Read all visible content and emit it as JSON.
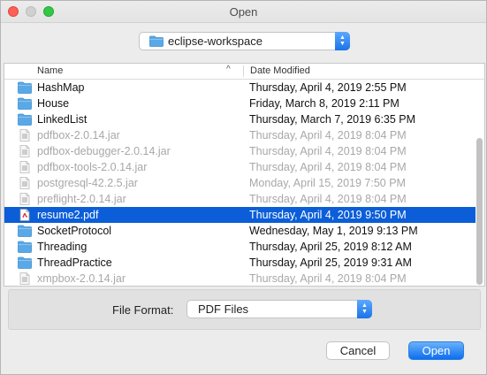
{
  "window": {
    "title": "Open"
  },
  "location": {
    "value": "eclipse-workspace"
  },
  "list": {
    "headers": {
      "name": "Name",
      "date": "Date Modified"
    },
    "rows": [
      {
        "name": "HashMap",
        "date": "Thursday, April 4, 2019 2:55 PM",
        "icon": "folder-icon",
        "enabled": true,
        "selected": false
      },
      {
        "name": "House",
        "date": "Friday, March 8, 2019 2:11 PM",
        "icon": "folder-icon",
        "enabled": true,
        "selected": false
      },
      {
        "name": "LinkedList",
        "date": "Thursday, March 7, 2019 6:35 PM",
        "icon": "folder-icon",
        "enabled": true,
        "selected": false
      },
      {
        "name": "pdfbox-2.0.14.jar",
        "date": "Thursday, April 4, 2019 8:04 PM",
        "icon": "jar-file-icon",
        "enabled": false,
        "selected": false
      },
      {
        "name": "pdfbox-debugger-2.0.14.jar",
        "date": "Thursday, April 4, 2019 8:04 PM",
        "icon": "jar-file-icon",
        "enabled": false,
        "selected": false
      },
      {
        "name": "pdfbox-tools-2.0.14.jar",
        "date": "Thursday, April 4, 2019 8:04 PM",
        "icon": "jar-file-icon",
        "enabled": false,
        "selected": false
      },
      {
        "name": "postgresql-42.2.5.jar",
        "date": "Monday, April 15, 2019 7:50 PM",
        "icon": "jar-file-icon",
        "enabled": false,
        "selected": false
      },
      {
        "name": "preflight-2.0.14.jar",
        "date": "Thursday, April 4, 2019 8:04 PM",
        "icon": "jar-file-icon",
        "enabled": false,
        "selected": false
      },
      {
        "name": "resume2.pdf",
        "date": "Thursday, April 4, 2019 9:50 PM",
        "icon": "pdf-file-icon",
        "enabled": true,
        "selected": true
      },
      {
        "name": "SocketProtocol",
        "date": "Wednesday, May 1, 2019 9:13 PM",
        "icon": "folder-icon",
        "enabled": true,
        "selected": false
      },
      {
        "name": "Threading",
        "date": "Thursday, April 25, 2019 8:12 AM",
        "icon": "folder-icon",
        "enabled": true,
        "selected": false
      },
      {
        "name": "ThreadPractice",
        "date": "Thursday, April 25, 2019 9:31 AM",
        "icon": "folder-icon",
        "enabled": true,
        "selected": false
      },
      {
        "name": "xmpbox-2.0.14.jar",
        "date": "Thursday, April 4, 2019 8:04 PM",
        "icon": "jar-file-icon",
        "enabled": false,
        "selected": false
      }
    ]
  },
  "file_format": {
    "label": "File Format:",
    "value": "PDF Files"
  },
  "buttons": {
    "cancel": "Cancel",
    "open": "Open"
  },
  "colors": {
    "selection": "#0b5ed7",
    "folder": "#5aa9e6",
    "accent": "#1a73e8"
  }
}
